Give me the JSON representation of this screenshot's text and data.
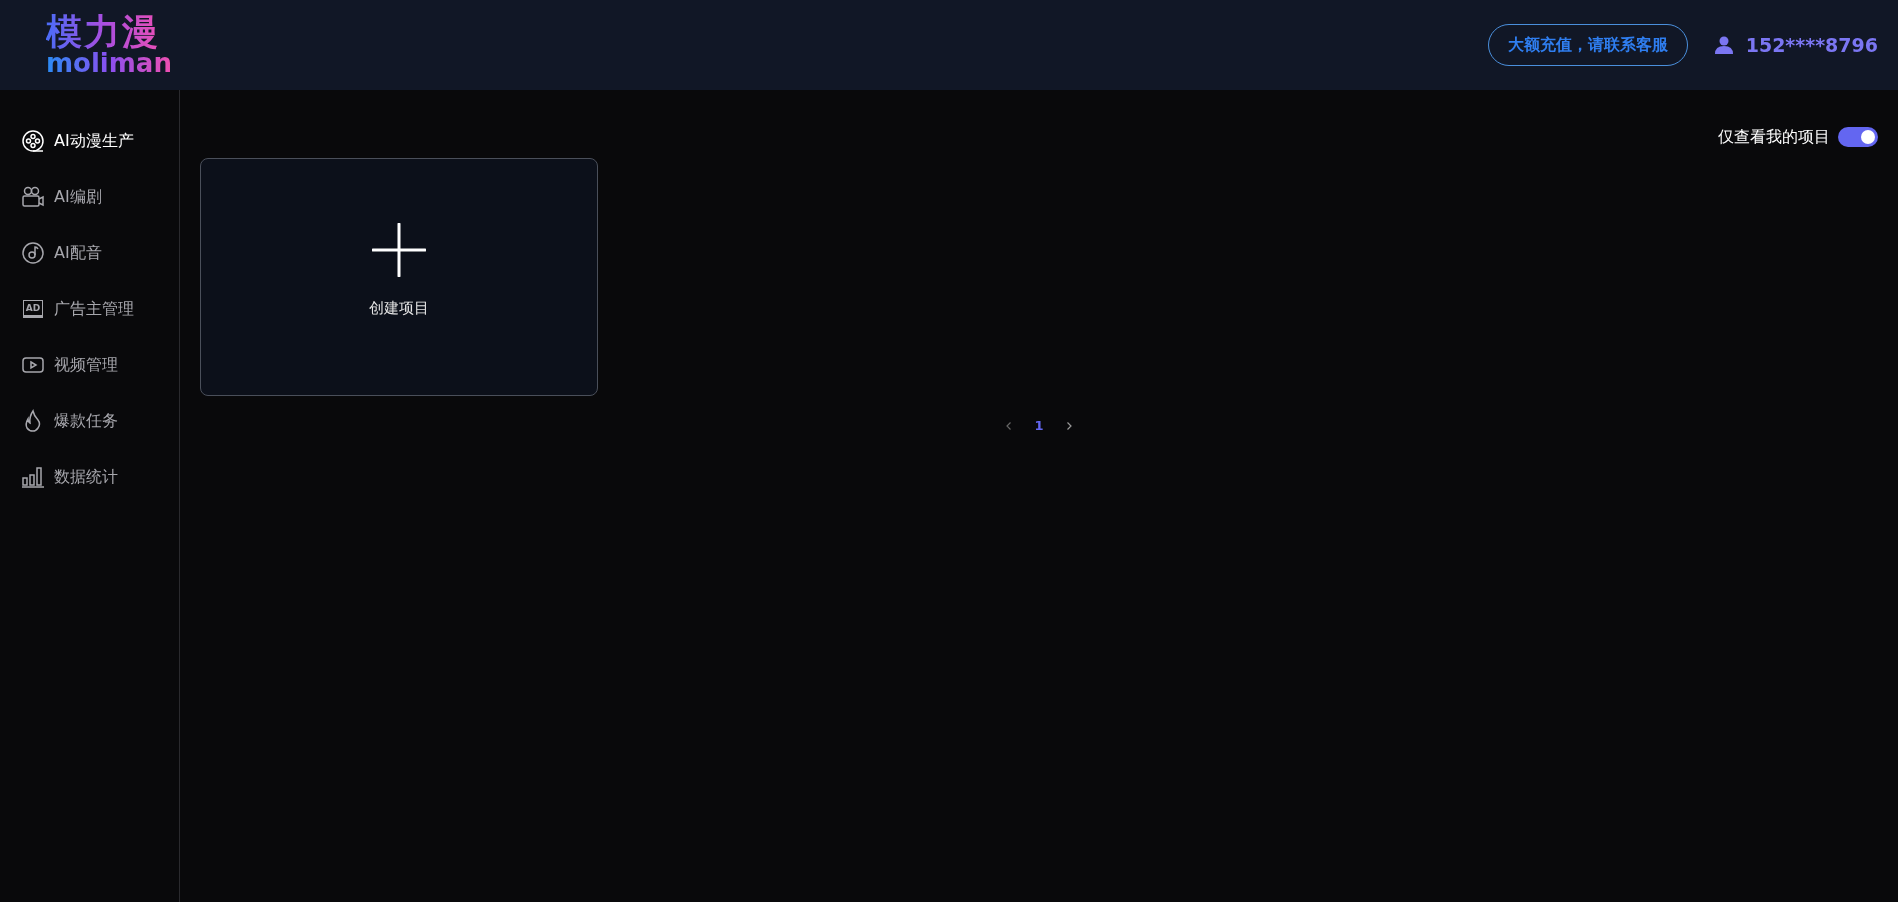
{
  "logo": {
    "title": "模力漫",
    "subtitle": "moliman"
  },
  "header": {
    "recharge_button": "大额充值，请联系客服",
    "user": "152****8796"
  },
  "sidebar": {
    "items": [
      {
        "label": "AI动漫生产",
        "kind": "film",
        "selected": true
      },
      {
        "label": "AI编剧",
        "kind": "camera",
        "selected": false
      },
      {
        "label": "AI配音",
        "kind": "music",
        "selected": false
      },
      {
        "label": "广告主管理",
        "kind": "ad",
        "icon_text": "AD",
        "selected": false
      },
      {
        "label": "视频管理",
        "kind": "video",
        "selected": false
      },
      {
        "label": "爆款任务",
        "kind": "fire",
        "selected": false
      },
      {
        "label": "数据统计",
        "kind": "chart",
        "selected": false
      }
    ]
  },
  "filter": {
    "label": "仅查看我的项目",
    "on": true
  },
  "create_card": {
    "label": "创建项目"
  },
  "pagination": {
    "pages": [
      {
        "label": "1",
        "selected": true
      }
    ]
  }
}
